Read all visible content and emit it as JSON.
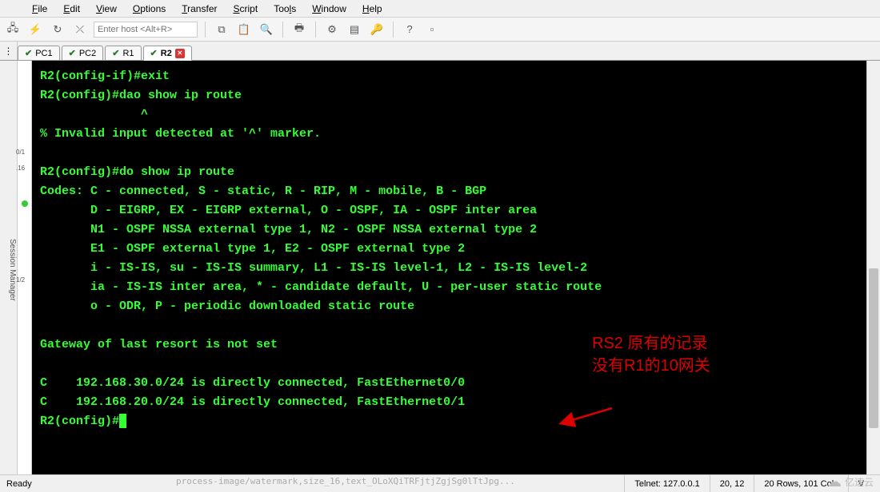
{
  "menu": [
    "File",
    "Edit",
    "View",
    "Options",
    "Transfer",
    "Script",
    "Tools",
    "Window",
    "Help"
  ],
  "toolbar_placeholder": "Enter host <Alt+R>",
  "tabs": [
    {
      "label": "PC1",
      "active": false
    },
    {
      "label": "PC2",
      "active": false
    },
    {
      "label": "R1",
      "active": false
    },
    {
      "label": "R2",
      "active": true
    }
  ],
  "sidebar_label": "Session Manager",
  "device_labels": {
    "a": "0/1",
    "b": ".16",
    "c": "1/2"
  },
  "terminal": {
    "lines": [
      "R2(config-if)#exit",
      "R2(config)#dao show ip route",
      "              ^",
      "% Invalid input detected at '^' marker.",
      "",
      "R2(config)#do show ip route",
      "Codes: C - connected, S - static, R - RIP, M - mobile, B - BGP",
      "       D - EIGRP, EX - EIGRP external, O - OSPF, IA - OSPF inter area",
      "       N1 - OSPF NSSA external type 1, N2 - OSPF NSSA external type 2",
      "       E1 - OSPF external type 1, E2 - OSPF external type 2",
      "       i - IS-IS, su - IS-IS summary, L1 - IS-IS level-1, L2 - IS-IS level-2",
      "       ia - IS-IS inter area, * - candidate default, U - per-user static route",
      "       o - ODR, P - periodic downloaded static route",
      "",
      "Gateway of last resort is not set",
      "",
      "C    192.168.30.0/24 is directly connected, FastEthernet0/0",
      "C    192.168.20.0/24 is directly connected, FastEthernet0/1",
      "R2(config)#"
    ]
  },
  "annotation": {
    "line1": "RS2 原有的记录",
    "line2": "没有R1的10网关"
  },
  "status": {
    "ready": "Ready",
    "conn": "Telnet: 127.0.0.1",
    "pos": "20,  12",
    "size": "20 Rows, 101 Cols",
    "vt": "V"
  },
  "faded_text": "process-image/watermark,size_16,text_OLoXQiTRFjtjZgjSg0lTtJpg...",
  "logo_text": "亿速云"
}
